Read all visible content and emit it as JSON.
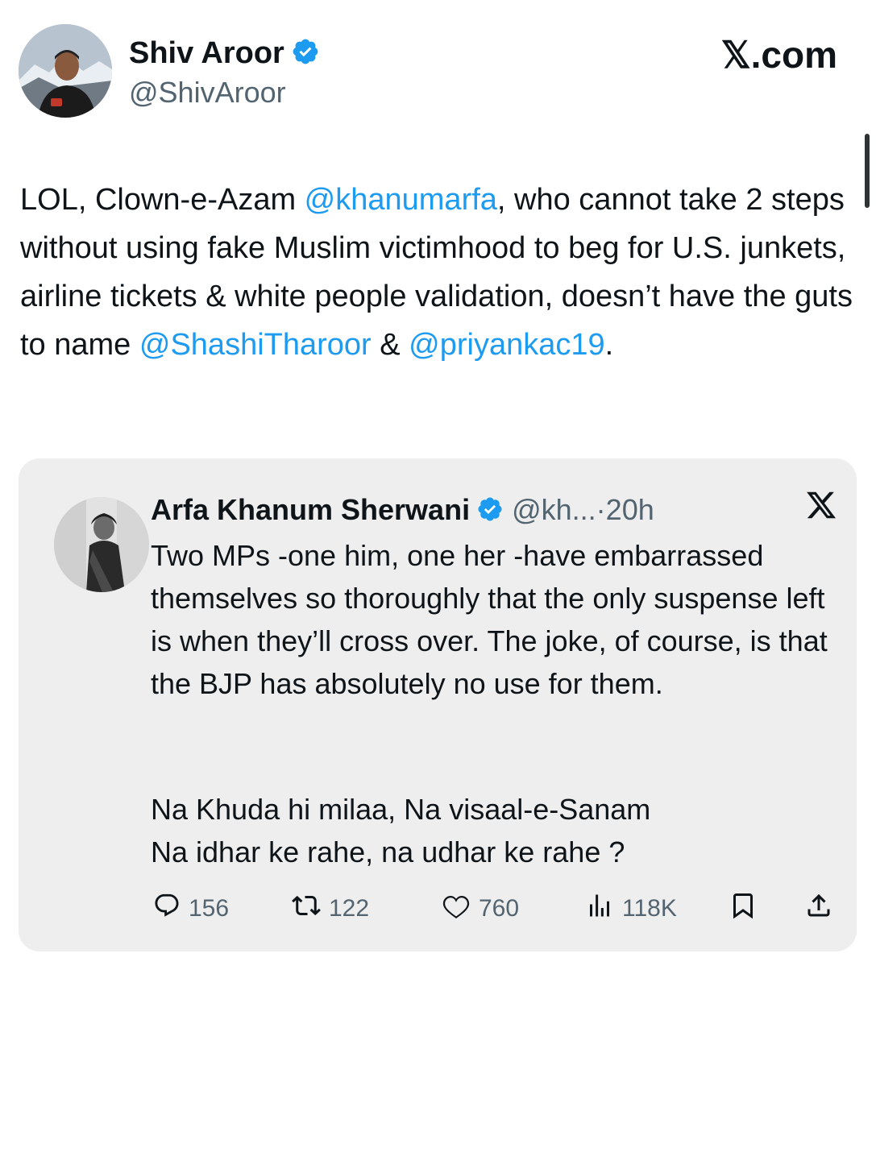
{
  "author": {
    "name": "Shiv Aroor",
    "handle": "@ShivAroor"
  },
  "site": {
    "label": "𝕏.com"
  },
  "tweet": {
    "text_1": "LOL, Clown-e-Azam ",
    "mention_1": "@khanumarfa",
    "text_2": ", who cannot take 2 steps without using fake Muslim victimhood to beg for U.S. junkets, airline tickets & white people validation, doesn’t have the guts to name ",
    "mention_2": "@ShashiTharoor",
    "text_3": " & ",
    "mention_3": "@priyankac19",
    "text_4": "."
  },
  "quote": {
    "name": "Arfa Khanum Sherwani",
    "handle": "@kh...",
    "separator": "·",
    "time": "20h",
    "x_logo": "𝕏",
    "body": "Two MPs -one him, one her -have embarrassed themselves so thoroughly that the only suspense left is when they’ll cross over. The joke, of course, is that the BJP has absolutely no use for them.",
    "verse": "Na Khuda hi milaa, Na visaal-e-Sanam\nNa idhar ke rahe, na udhar ke rahe ?",
    "stats": {
      "replies": "156",
      "reposts": "122",
      "likes": "760",
      "views": "118K"
    }
  },
  "colors": {
    "link": "#1d9bf0",
    "verified": "#1d9bf0",
    "card_bg": "#eeeeee",
    "muted": "#536471"
  }
}
